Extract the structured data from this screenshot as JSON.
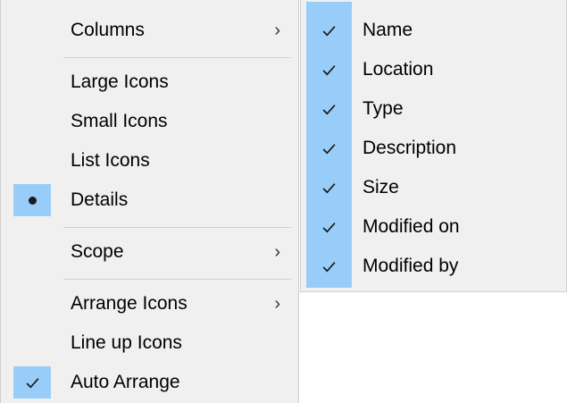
{
  "main_menu": {
    "columns": {
      "label": "Columns",
      "arrow": "›"
    },
    "large_icons": {
      "label": "Large Icons"
    },
    "small_icons": {
      "label": "Small Icons"
    },
    "list_icons": {
      "label": "List Icons"
    },
    "details": {
      "label": "Details",
      "selected": true,
      "indicator": "bullet"
    },
    "scope": {
      "label": "Scope",
      "arrow": "›"
    },
    "arrange_icons": {
      "label": "Arrange Icons",
      "arrow": "›"
    },
    "line_up_icons": {
      "label": "Line up Icons"
    },
    "auto_arrange": {
      "label": "Auto Arrange",
      "checked": true,
      "indicator": "checkmark"
    }
  },
  "columns_submenu": {
    "items": [
      {
        "label": "Name",
        "checked": true
      },
      {
        "label": "Location",
        "checked": true
      },
      {
        "label": "Type",
        "checked": true
      },
      {
        "label": "Description",
        "checked": true
      },
      {
        "label": "Size",
        "checked": true
      },
      {
        "label": "Modified on",
        "checked": true
      },
      {
        "label": "Modified by",
        "checked": true
      }
    ]
  },
  "colors": {
    "menu_bg": "#f0f0f0",
    "highlight": "#99cdf9",
    "separator": "#d3d3d3"
  }
}
